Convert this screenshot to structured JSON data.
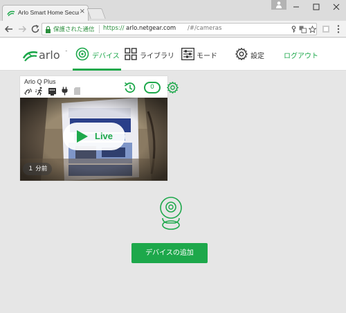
{
  "browser": {
    "tab_title": "Arlo Smart Home Securi",
    "tab_close": "×",
    "security_label": "保護された通信",
    "url_scheme": "https://",
    "url_host": "arlo.netgear.com",
    "url_path": "/#/cameras"
  },
  "header": {
    "nav": [
      {
        "label": "デバイス",
        "icon": "devices-icon"
      },
      {
        "label": "ライブラリ",
        "icon": "library-icon"
      },
      {
        "label": "モード",
        "icon": "mode-icon"
      },
      {
        "label": "設定",
        "icon": "settings-icon"
      }
    ],
    "logout": "ログアウト",
    "active_color": "#1da84b"
  },
  "camera_card": {
    "name": "Arlo Q Plus",
    "clip_count": "0",
    "live_label": "Live",
    "last_update": "１ 分前",
    "status_icons": [
      "audio-icon",
      "motion-icon",
      "ethernet-icon",
      "power-plug-icon",
      "sd-card-icon"
    ]
  },
  "main": {
    "add_device_label": "デバイスの追加"
  }
}
